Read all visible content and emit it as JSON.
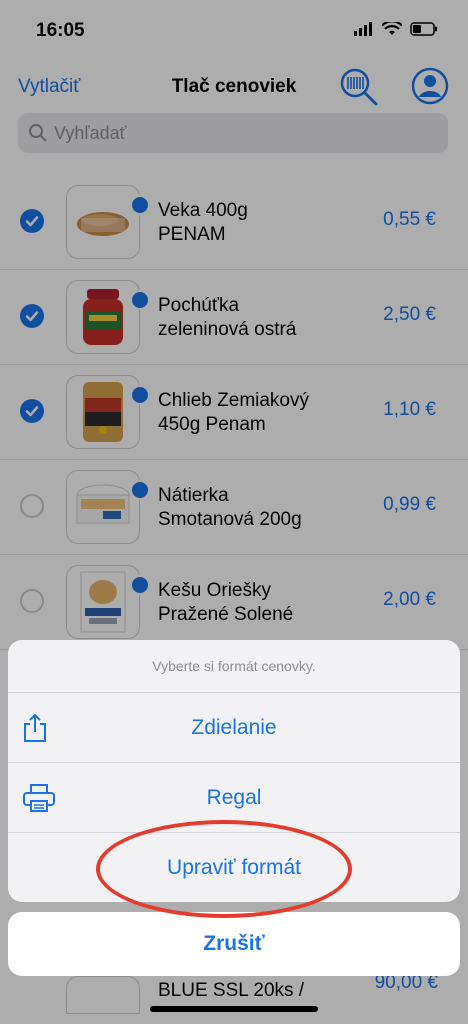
{
  "status": {
    "time": "16:05"
  },
  "nav": {
    "left_action": "Vytlačiť",
    "title": "Tlač cenoviek"
  },
  "search": {
    "placeholder": "Vyhľadať"
  },
  "products": [
    {
      "name_line1": "Veka 400g",
      "name_line2": "PENAM",
      "price": "0,55 €",
      "checked": true
    },
    {
      "name_line1": "Pochúťka",
      "name_line2": "zeleninová ostrá",
      "price": "2,50 €",
      "checked": true
    },
    {
      "name_line1": "Chlieb Zemiakový",
      "name_line2": "450g Penam",
      "price": "1,10 €",
      "checked": true
    },
    {
      "name_line1": "Nátierka",
      "name_line2": "Smotanová 200g",
      "price": "0,99 €",
      "checked": false
    },
    {
      "name_line1": "Kešu Oriešky",
      "name_line2": "Pražené Solené",
      "price": "2,00 €",
      "checked": false
    }
  ],
  "peek_row": {
    "name": "BLUE SSL 20ks /",
    "price": "90,00 €"
  },
  "action_sheet": {
    "title": "Vyberte si formát cenovky.",
    "items": [
      {
        "label": "Zdielanie",
        "icon": "share-icon"
      },
      {
        "label": "Regal",
        "icon": "printer-icon"
      },
      {
        "label": "Upraviť formát",
        "icon": ""
      }
    ],
    "cancel_label": "Zrušiť"
  },
  "colors": {
    "accent": "#1a73e8",
    "annotation": "#e53b2c"
  }
}
